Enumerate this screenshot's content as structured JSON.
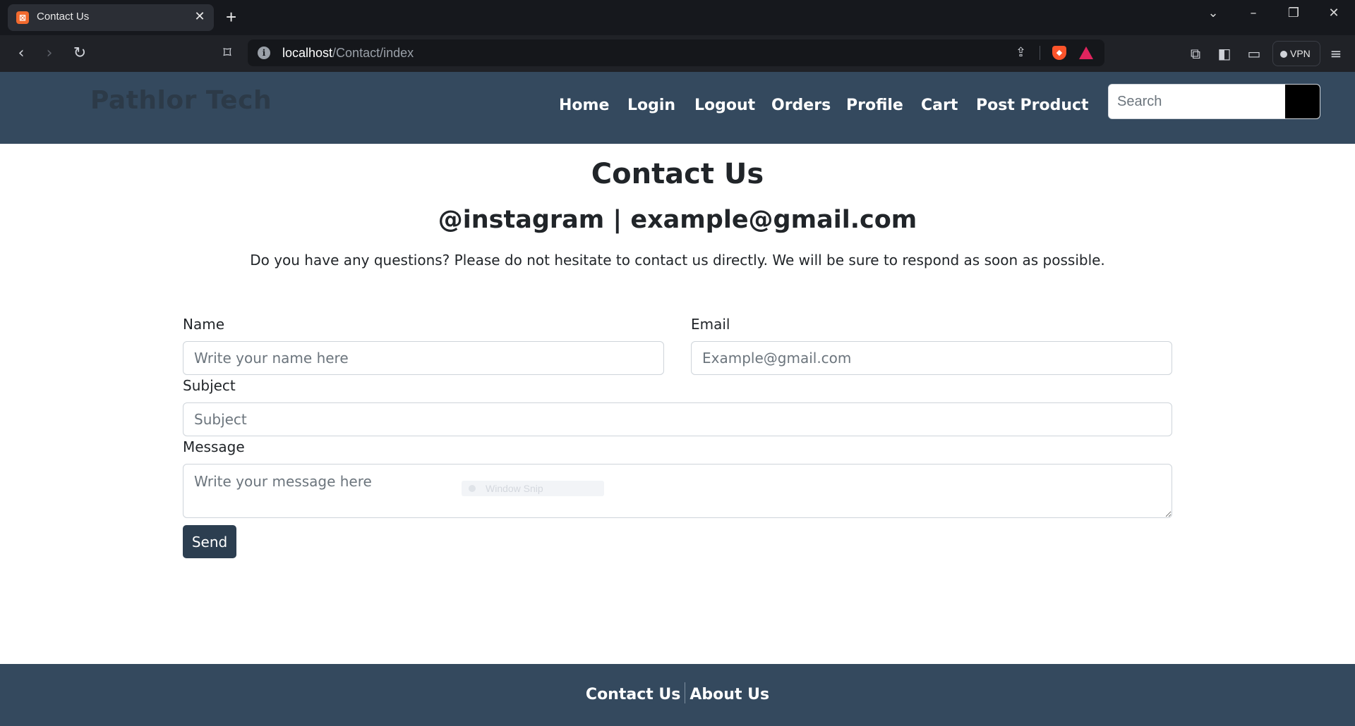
{
  "browser": {
    "tab_title": "Contact Us",
    "tab_favicon_glyph": "⊠",
    "url_host": "localhost",
    "url_path": "/Contact/index",
    "vpn_label": "VPN",
    "icons": [
      "back-icon",
      "forward-icon",
      "reload-icon",
      "bookmark-icon",
      "site-info-icon",
      "share-icon",
      "brave-shield-icon",
      "brave-rewards-icon",
      "extensions-icon",
      "sidebar-icon",
      "wallet-icon",
      "menu-icon"
    ]
  },
  "header": {
    "brand": "Pathlor Tech",
    "nav": [
      "Home",
      "Login",
      "Logout",
      "Orders",
      "Profile",
      "Cart",
      "Post Product"
    ],
    "search_placeholder": "Search"
  },
  "contact": {
    "title": "Contact Us",
    "subtitle": "@instagram | example@gmail.com",
    "lead": "Do you have any questions? Please do not hesitate to contact us directly. We will be sure to respond as soon as possible.",
    "name_label": "Name",
    "name_placeholder": "Write your name here",
    "email_label": "Email",
    "email_placeholder": "Example@gmail.com",
    "subject_label": "Subject",
    "subject_placeholder": "Subject",
    "message_label": "Message",
    "message_placeholder": "Write your message here",
    "send_label": "Send",
    "overlay_text": "Window Snip"
  },
  "footer": {
    "links": [
      "Contact Us",
      "About Us"
    ]
  },
  "colors": {
    "header_bg": "#34495e",
    "button_bg": "#2c3e50",
    "brand_text": "#2c3a48"
  }
}
